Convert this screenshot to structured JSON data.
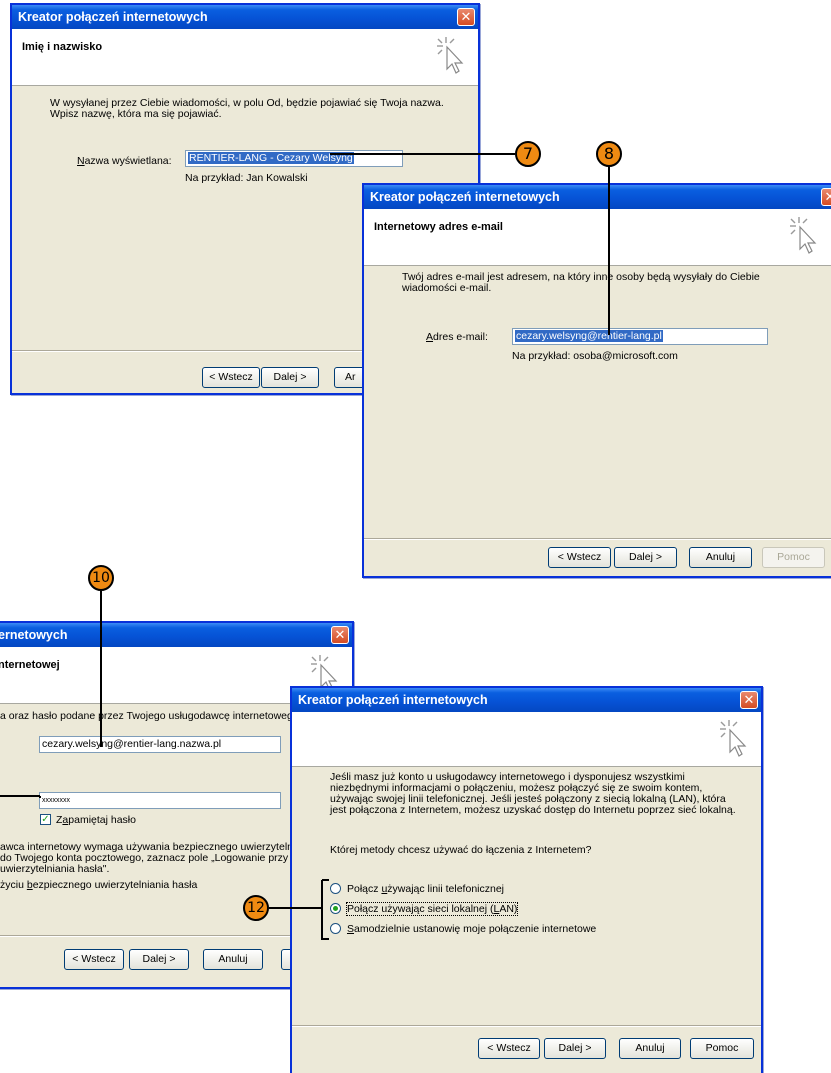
{
  "wizard_title": "Kreator połączeń internetowych",
  "buttons": {
    "back": "< Wstecz",
    "next": "Dalej >",
    "cancel": "Anuluj",
    "help": "Pomoc",
    "cancel_partial": "Ar"
  },
  "win1": {
    "header_title": "Imię i nazwisko",
    "intro_line1": "W wysyłanej przez Ciebie wiadomości, w polu Od, będzie pojawiać się Twoja nazwa.",
    "intro_line2": "Wpisz nazwę, która ma się pojawiać.",
    "field_label": "Nazwa wyświetlana:",
    "field_value": "RENTIER-LANG - Cezary Welsyng",
    "example": "Na przykład: Jan Kowalski"
  },
  "win2": {
    "header_title": "Internetowy adres e-mail",
    "intro_line1": "Twój adres e-mail jest adresem, na który inne osoby będą wysyłały do Ciebie",
    "intro_line2": "wiadomości e-mail.",
    "field_label": "Adres e-mail:",
    "field_value": "cezary.welsyng@rentier-lang.pl",
    "example": "Na przykład: osoba@microsoft.com"
  },
  "win3": {
    "title_partial": "ernetowych",
    "header_title_partial": "nternetowej",
    "intro": "a oraz hasło podane przez Twojego usługodawcę internetowego.",
    "account_value": "cezary.welsyng@rentier-lang.nazwa.pl",
    "password_value": "xxxxxxxx",
    "remember_label": "Zapamiętaj hasło",
    "spa_line1": "awca internetowy wymaga używania bezpiecznego uwierzytelniania",
    "spa_line2": "do Twojego konta pocztowego, zaznacz pole „Logowanie przy",
    "spa_line3": "uwierzytelniania hasła\".",
    "spa_checkbox_label": "życiu bezpiecznego uwierzytelniania hasła"
  },
  "win4": {
    "para_line1": "Jeśli masz już konto u usługodawcy internetowego i dysponujesz wszystkimi",
    "para_line2": "niezbędnymi informacjami o połączeniu, możesz połączyć się ze swoim kontem,",
    "para_line3": "używając swojej linii telefonicznej. Jeśli jesteś połączony z siecią lokalną (LAN), która",
    "para_line4": "jest połączona z Internetem, możesz uzyskać dostęp do Internetu poprzez sieć lokalną.",
    "question": "Której metody chcesz używać do łączenia z Internetem?",
    "options": [
      {
        "label": "Połącz używając linii telefonicznej",
        "selected": false
      },
      {
        "label": "Połącz używając sieci lokalnej (LAN)",
        "selected": true
      },
      {
        "label": "Samodzielnie ustanowię moje połączenie internetowe",
        "selected": false
      }
    ]
  },
  "callouts": {
    "c7": "7",
    "c8": "8",
    "c10": "10",
    "c12": "12"
  },
  "colors": {
    "titlebar": "#0653d6",
    "dialog_bg": "#ece9d8",
    "callout": "#ef8a12",
    "selection": "#316ac5"
  }
}
